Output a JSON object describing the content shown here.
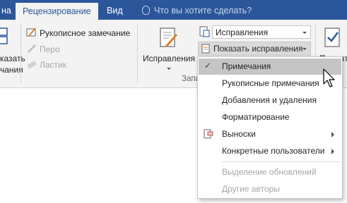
{
  "tabs": {
    "partial": "на",
    "review": "Рецензирование",
    "view": "Вид",
    "tellme": "Что вы хотите сделать?"
  },
  "ink": {
    "comment": "Рукописное замечание",
    "pen": "Перо",
    "eraser": "Ластик"
  },
  "left_button": {
    "line1": "казать",
    "line2": "чания"
  },
  "tracking": {
    "big_button": "Исправления",
    "display_combo": "Исправления",
    "show_markup": "Показать исправления",
    "group_label": "Запи",
    "accept_partial": "Принят"
  },
  "menu": {
    "items": [
      {
        "label": "Примечания",
        "checked": true,
        "enabled": true,
        "submenu": false
      },
      {
        "label": "Рукописные примечания",
        "checked": false,
        "enabled": true,
        "submenu": false
      },
      {
        "label": "Добавления и удаления",
        "checked": false,
        "enabled": true,
        "submenu": false
      },
      {
        "label": "Форматирование",
        "checked": false,
        "enabled": true,
        "submenu": false
      },
      {
        "label": "Выноски",
        "checked": false,
        "enabled": true,
        "submenu": true
      },
      {
        "label": "Конкретные пользователи",
        "checked": false,
        "enabled": true,
        "submenu": true
      },
      {
        "label": "Выделение обновлений",
        "checked": false,
        "enabled": false,
        "submenu": false
      },
      {
        "label": "Другие авторы",
        "checked": false,
        "enabled": false,
        "submenu": false
      }
    ]
  },
  "colors": {
    "brand": "#2b579a",
    "ribbon": "#f3f3f3",
    "hover": "#c5c5c5"
  }
}
